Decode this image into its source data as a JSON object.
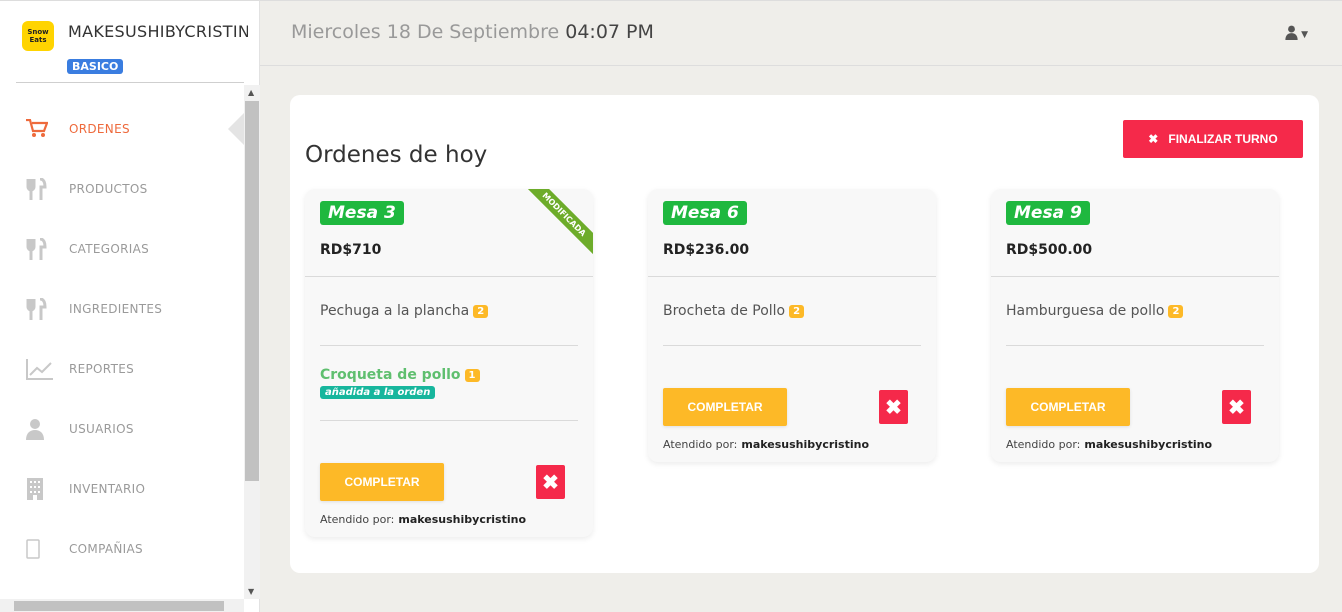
{
  "brand": {
    "logo_text": "Snow Eats",
    "name": "MAKESUSHIBYCRISTINO",
    "plan": "BASICO"
  },
  "nav": [
    {
      "label": "ORDENES",
      "icon": "cart-icon",
      "active": true
    },
    {
      "label": "PRODUCTOS",
      "icon": "utensils-icon"
    },
    {
      "label": "CATEGORIAS",
      "icon": "utensils-icon"
    },
    {
      "label": "INGREDIENTES",
      "icon": "utensils-icon"
    },
    {
      "label": "REPORTES",
      "icon": "line-chart-icon"
    },
    {
      "label": "USUARIOS",
      "icon": "user-icon"
    },
    {
      "label": "INVENTARIO",
      "icon": "building-icon"
    },
    {
      "label": "COMPAÑIAS",
      "icon": "mobile-icon"
    }
  ],
  "header": {
    "date": "Miercoles 18 De Septiembre",
    "time": "04:07 PM",
    "user_icon": "user-icon"
  },
  "main": {
    "title": "Ordenes de hoy",
    "end_shift_label": "FINALIZAR TURNO",
    "complete_label": "COMPLETAR",
    "attended_prefix": "Atendido por:",
    "orders": [
      {
        "table": "Mesa 3",
        "total": "RD$710",
        "ribbon": "MODIFICADA",
        "items": [
          {
            "name": "Pechuga a la plancha",
            "qty": "2"
          },
          {
            "name": "Croqueta de pollo",
            "qty": "1",
            "tag": "añadida a la orden"
          }
        ],
        "attended_by": "makesushibycristino"
      },
      {
        "table": "Mesa 6",
        "total": "RD$236.00",
        "items": [
          {
            "name": "Brocheta de Pollo",
            "qty": "2"
          }
        ],
        "attended_by": "makesushibycristino"
      },
      {
        "table": "Mesa 9",
        "total": "RD$500.00",
        "items": [
          {
            "name": "Hamburguesa de pollo",
            "qty": "2"
          }
        ],
        "attended_by": "makesushibycristino"
      }
    ]
  },
  "colors": {
    "accent": "#ee6a3c",
    "danger": "#f5294a",
    "warning": "#fdb927",
    "success": "#1fb83f",
    "primary": "#3a7de0"
  }
}
